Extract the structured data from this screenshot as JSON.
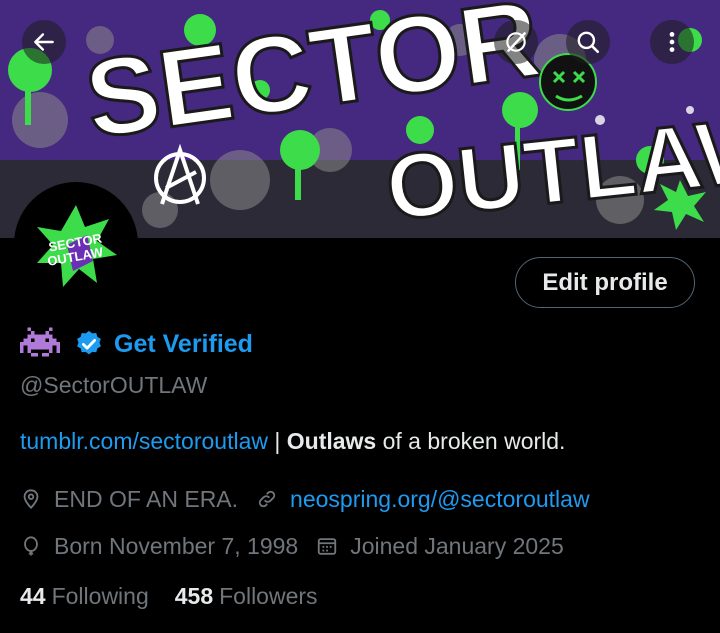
{
  "banner": {
    "art_text_1": "SECTOR",
    "art_text_2": "OUTLAW",
    "colors": {
      "purple": "#4b2a8a",
      "green": "#3ddc4a",
      "white": "#ffffff"
    }
  },
  "topbar": {
    "back_icon": "arrow-left-icon",
    "grok_icon": "grok-icon",
    "search_icon": "search-icon",
    "more_icon": "more-vertical-icon"
  },
  "profile": {
    "edit_button_label": "Edit profile",
    "emoji": "👾",
    "verified_label": "Get Verified",
    "handle": "@SectorOUTLAW",
    "bio_link": "tumblr.com/sectoroutlaw",
    "bio_sep": " | ",
    "bio_bold": "Outlaws",
    "bio_rest": " of a broken world.",
    "location": "END OF AN ERA.",
    "website": "neospring.org/@sectoroutlaw",
    "birthday": "Born November 7, 1998",
    "joined": "Joined January 2025",
    "following_count": "44",
    "following_label": "Following",
    "followers_count": "458",
    "followers_label": "Followers"
  },
  "colors": {
    "link": "#1d9bf0",
    "muted": "#71767b",
    "text": "#e7e9ea",
    "background": "#000000"
  }
}
